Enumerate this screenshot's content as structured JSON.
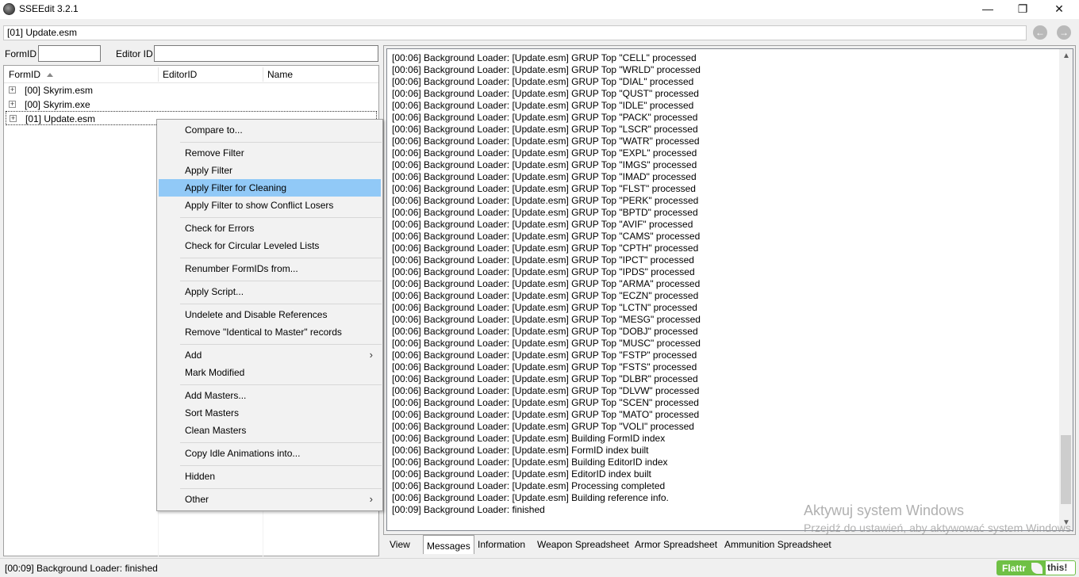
{
  "window": {
    "title": "SSEEdit 3.2.1",
    "minimize": "—",
    "maximize": "❐",
    "close": "✕"
  },
  "pathbar": {
    "value": "[01] Update.esm",
    "back": "←",
    "forward": "→"
  },
  "filters": {
    "formid_label": "FormID",
    "formid_value": "",
    "editorid_label": "Editor ID",
    "editorid_value": ""
  },
  "tree": {
    "columns": [
      "FormID",
      "EditorID",
      "Name"
    ],
    "rows": [
      {
        "label": "[00] Skyrim.esm",
        "expander": "+"
      },
      {
        "label": "[00] Skyrim.exe",
        "expander": "+"
      },
      {
        "label": "[01] Update.esm",
        "expander": "+"
      }
    ]
  },
  "context_menu": {
    "items": [
      "Compare to...",
      "Remove Filter",
      "Apply Filter",
      "Apply Filter for Cleaning",
      "Apply Filter to show Conflict Losers",
      "Check for Errors",
      "Check for Circular Leveled Lists",
      "Renumber FormIDs from...",
      "Apply Script...",
      "Undelete and Disable References",
      "Remove \"Identical to Master\" records",
      "Add",
      "Mark Modified",
      "Add Masters...",
      "Sort Masters",
      "Clean Masters",
      "Copy Idle Animations into...",
      "Hidden",
      "Other"
    ],
    "highlighted": "Apply Filter for Cleaning",
    "submenu_arrow": "›"
  },
  "messages": [
    "[00:06] Background Loader: [Update.esm] GRUP Top \"CELL\" processed",
    "[00:06] Background Loader: [Update.esm] GRUP Top \"WRLD\" processed",
    "[00:06] Background Loader: [Update.esm] GRUP Top \"DIAL\" processed",
    "[00:06] Background Loader: [Update.esm] GRUP Top \"QUST\" processed",
    "[00:06] Background Loader: [Update.esm] GRUP Top \"IDLE\" processed",
    "[00:06] Background Loader: [Update.esm] GRUP Top \"PACK\" processed",
    "[00:06] Background Loader: [Update.esm] GRUP Top \"LSCR\" processed",
    "[00:06] Background Loader: [Update.esm] GRUP Top \"WATR\" processed",
    "[00:06] Background Loader: [Update.esm] GRUP Top \"EXPL\" processed",
    "[00:06] Background Loader: [Update.esm] GRUP Top \"IMGS\" processed",
    "[00:06] Background Loader: [Update.esm] GRUP Top \"IMAD\" processed",
    "[00:06] Background Loader: [Update.esm] GRUP Top \"FLST\" processed",
    "[00:06] Background Loader: [Update.esm] GRUP Top \"PERK\" processed",
    "[00:06] Background Loader: [Update.esm] GRUP Top \"BPTD\" processed",
    "[00:06] Background Loader: [Update.esm] GRUP Top \"AVIF\" processed",
    "[00:06] Background Loader: [Update.esm] GRUP Top \"CAMS\" processed",
    "[00:06] Background Loader: [Update.esm] GRUP Top \"CPTH\" processed",
    "[00:06] Background Loader: [Update.esm] GRUP Top \"IPCT\" processed",
    "[00:06] Background Loader: [Update.esm] GRUP Top \"IPDS\" processed",
    "[00:06] Background Loader: [Update.esm] GRUP Top \"ARMA\" processed",
    "[00:06] Background Loader: [Update.esm] GRUP Top \"ECZN\" processed",
    "[00:06] Background Loader: [Update.esm] GRUP Top \"LCTN\" processed",
    "[00:06] Background Loader: [Update.esm] GRUP Top \"MESG\" processed",
    "[00:06] Background Loader: [Update.esm] GRUP Top \"DOBJ\" processed",
    "[00:06] Background Loader: [Update.esm] GRUP Top \"MUSC\" processed",
    "[00:06] Background Loader: [Update.esm] GRUP Top \"FSTP\" processed",
    "[00:06] Background Loader: [Update.esm] GRUP Top \"FSTS\" processed",
    "[00:06] Background Loader: [Update.esm] GRUP Top \"DLBR\" processed",
    "[00:06] Background Loader: [Update.esm] GRUP Top \"DLVW\" processed",
    "[00:06] Background Loader: [Update.esm] GRUP Top \"SCEN\" processed",
    "[00:06] Background Loader: [Update.esm] GRUP Top \"MATO\" processed",
    "[00:06] Background Loader: [Update.esm] GRUP Top \"VOLI\" processed",
    "[00:06] Background Loader: [Update.esm] Building FormID index",
    "[00:06] Background Loader: [Update.esm] FormID index built",
    "[00:06] Background Loader: [Update.esm] Building EditorID index",
    "[00:06] Background Loader: [Update.esm] EditorID index built",
    "[00:06] Background Loader: [Update.esm] Processing completed",
    "[00:06] Background Loader: [Update.esm] Building reference info.",
    "[00:09] Background Loader: finished"
  ],
  "scrollbar": {
    "up": "▲",
    "down": "▼"
  },
  "tabs": {
    "labels": [
      "View",
      "Messages",
      "Information",
      "Weapon Spreadsheet",
      "Armor Spreadsheet",
      "Ammunition Spreadsheet"
    ],
    "active": "Messages"
  },
  "watermark": {
    "line1": "Aktywuj system Windows",
    "line2": "Przejdź do ustawień, aby aktywować system Windows."
  },
  "status": {
    "text": "[00:09] Background Loader: finished"
  },
  "flattr": {
    "left": "Flattr",
    "right": "this!"
  }
}
